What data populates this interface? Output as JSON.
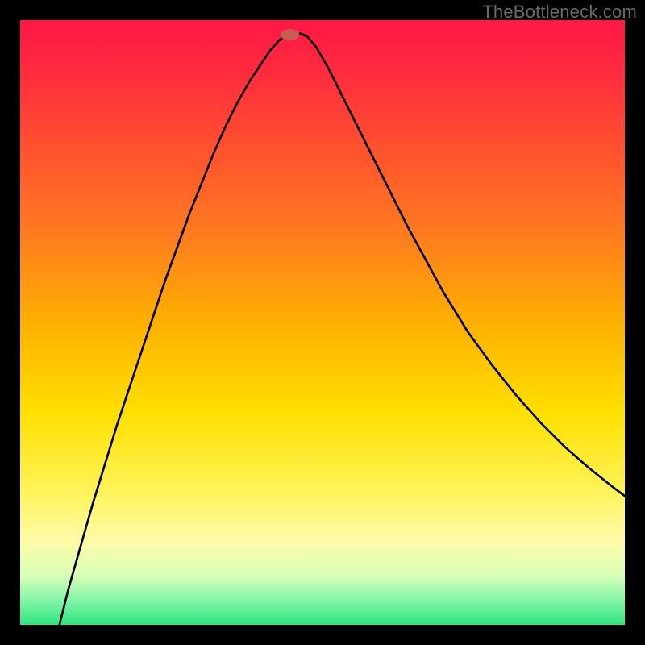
{
  "attribution": "TheBottleneck.com",
  "chart_data": {
    "type": "line",
    "title": "",
    "xlabel": "",
    "ylabel": "",
    "xlim": [
      0,
      100
    ],
    "ylim": [
      0,
      100
    ],
    "grid": false,
    "gradient_stops": [
      {
        "offset": 0.0,
        "color": "#ff1744"
      },
      {
        "offset": 0.08,
        "color": "#ff2a3f"
      },
      {
        "offset": 0.2,
        "color": "#ff4d30"
      },
      {
        "offset": 0.35,
        "color": "#ff7a20"
      },
      {
        "offset": 0.5,
        "color": "#ffb000"
      },
      {
        "offset": 0.65,
        "color": "#ffe000"
      },
      {
        "offset": 0.78,
        "color": "#fff45a"
      },
      {
        "offset": 0.86,
        "color": "#fffba8"
      },
      {
        "offset": 0.92,
        "color": "#d6ffb8"
      },
      {
        "offset": 0.96,
        "color": "#82f5a8"
      },
      {
        "offset": 1.0,
        "color": "#2fe47e"
      }
    ],
    "marker": {
      "x": 44.6,
      "y": 97.6,
      "color": "#c95b56",
      "rx": 1.6,
      "ry": 0.9
    },
    "series": [
      {
        "name": "bottleneck-curve",
        "color": "#000000",
        "x": [
          6.5,
          8.0,
          10.0,
          12.0,
          14.0,
          16.0,
          18.0,
          20.0,
          22.0,
          24.0,
          26.0,
          28.0,
          30.0,
          32.0,
          34.0,
          36.0,
          38.0,
          40.0,
          41.5,
          43.0,
          44.0,
          45.2,
          46.3,
          47.5,
          49.0,
          51.0,
          53.0,
          55.0,
          58.0,
          61.0,
          64.0,
          67.0,
          70.0,
          74.0,
          78.0,
          82.0,
          86.0,
          90.0,
          94.0,
          98.0,
          100.0
        ],
        "y": [
          0.0,
          6.0,
          13.0,
          20.0,
          26.5,
          33.0,
          39.0,
          45.0,
          51.0,
          57.0,
          62.5,
          68.0,
          73.0,
          78.0,
          82.5,
          86.5,
          90.0,
          93.0,
          95.2,
          96.8,
          97.5,
          97.8,
          97.8,
          97.3,
          95.5,
          92.0,
          88.0,
          84.0,
          78.0,
          72.0,
          66.0,
          60.5,
          55.0,
          48.5,
          43.0,
          38.0,
          33.5,
          29.5,
          26.0,
          22.8,
          21.3
        ]
      }
    ]
  }
}
